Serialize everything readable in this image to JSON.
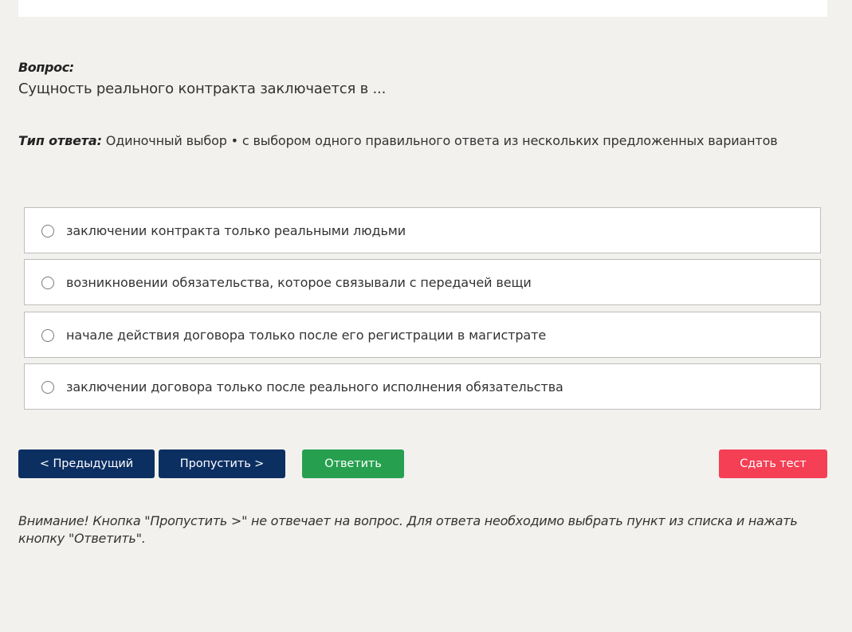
{
  "question": {
    "label": "Вопрос:",
    "text": "Сущность реального контракта заключается в ..."
  },
  "answer_type": {
    "label": "Тип ответа:",
    "value": "Одиночный выбор • с выбором одного правильного ответа из нескольких предложенных вариантов"
  },
  "options": [
    {
      "text": "заключении контракта только реальными людьми",
      "selected": false
    },
    {
      "text": "возникновении обязательства, которое связывали с передачей вещи",
      "selected": false
    },
    {
      "text": "начале действия договора только после его регистрации в магистрате",
      "selected": false
    },
    {
      "text": "заключении договора только после реального исполнения обязательства",
      "selected": false
    }
  ],
  "buttons": {
    "prev": "< Предыдущий",
    "skip": "Пропустить >",
    "answer": "Ответить",
    "submit": "Сдать тест"
  },
  "warning": "Внимание! Кнопка \"Пропустить >\" не отвечает на вопрос. Для ответа необходимо выбрать пункт из списка и нажать кнопку \"Ответить\".",
  "colors": {
    "background": "#f2f1ee",
    "nav_button": "#0c2f62",
    "answer_button": "#26a04f",
    "submit_button": "#f43f55"
  }
}
